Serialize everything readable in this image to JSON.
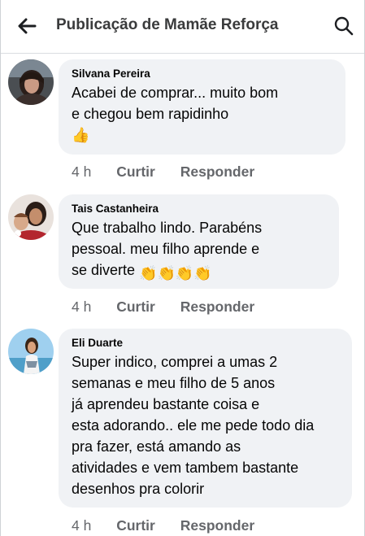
{
  "header": {
    "title": "Publicação de Mamãe Reforça"
  },
  "comments": [
    {
      "author": "Silvana Pereira",
      "lines": [
        "Acabei de comprar... muito bom",
        "e chegou bem rapidinho"
      ],
      "emoji": "👍",
      "time": "4 h",
      "like_label": "Curtir",
      "reply_label": "Responder"
    },
    {
      "author": "Tais Castanheira",
      "lines": [
        "Que trabalho lindo. Parabéns",
        "pessoal. meu filho aprende e",
        "se diverte"
      ],
      "emoji": "👏👏👏👏",
      "time": "4 h",
      "like_label": "Curtir",
      "reply_label": "Responder"
    },
    {
      "author": "Eli Duarte",
      "lines": [
        "Super indico, comprei a umas 2",
        "semanas e meu filho de 5 anos",
        "já aprendeu bastante coisa e",
        "esta adorando.. ele me pede todo dia",
        "pra fazer, está amando as",
        "atividades e vem tambem bastante",
        "desenhos pra colorir"
      ],
      "time": "4 h",
      "like_label": "Curtir",
      "reply_label": "Responder"
    }
  ],
  "icons": {
    "back": "arrow-left-icon",
    "search": "search-icon",
    "thumbs_up": "thumbs-up-emoji",
    "clap": "clapping-hands-emoji"
  },
  "colors": {
    "bubble": "#f0f2f5",
    "secondary_text": "#65676b",
    "title": "#3a3b3c"
  }
}
